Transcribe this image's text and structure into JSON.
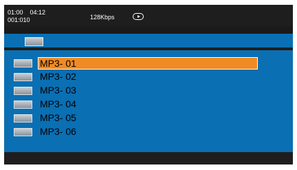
{
  "status": {
    "elapsed_time": "01:00",
    "total_time": "04:12",
    "track_counter": "001:010",
    "bitrate": "128Kbps",
    "play_state_icon": "play-circle-icon"
  },
  "path_bar": {
    "icon": "folder-icon"
  },
  "files": [
    {
      "name": "MP3- 01",
      "icon": "folder-icon",
      "selected": true
    },
    {
      "name": "MP3- 02",
      "icon": "folder-icon",
      "selected": false
    },
    {
      "name": "MP3- 03",
      "icon": "folder-icon",
      "selected": false
    },
    {
      "name": "MP3- 04",
      "icon": "folder-icon",
      "selected": false
    },
    {
      "name": "MP3- 05",
      "icon": "folder-icon",
      "selected": false
    },
    {
      "name": "MP3- 06",
      "icon": "folder-icon",
      "selected": false
    }
  ],
  "colors": {
    "background": "#1e1e1e",
    "list_blue": "#0a6fb3",
    "selection_orange": "#f08a24",
    "text": "#000000",
    "status_text": "#ffffff"
  }
}
